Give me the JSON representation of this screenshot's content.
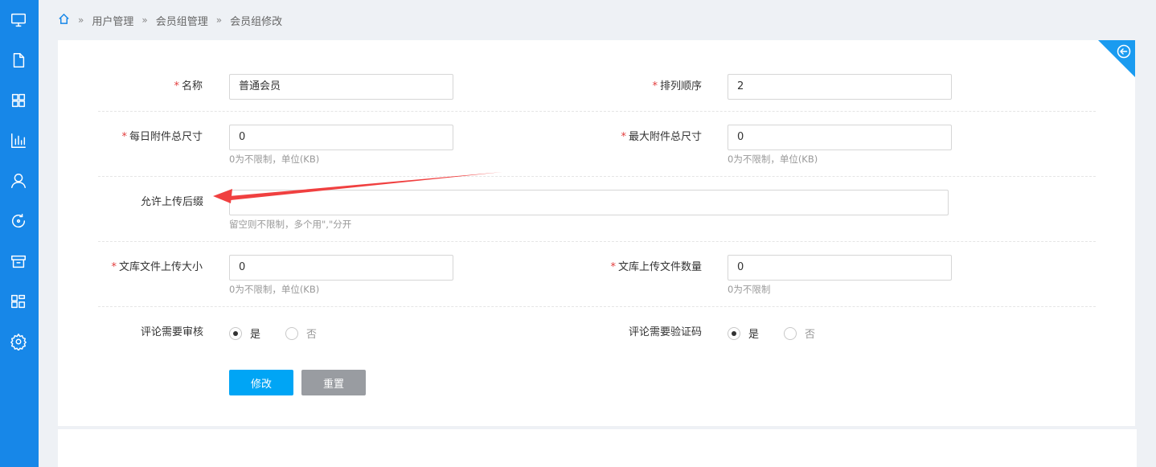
{
  "breadcrumb": {
    "items": [
      "用户管理",
      "会员组管理",
      "会员组修改"
    ],
    "separator": "»"
  },
  "sidebar": {
    "icons": [
      "monitor-icon",
      "file-icon",
      "grid-icon",
      "bar-chart-icon",
      "user-icon",
      "refresh-icon",
      "archive-icon",
      "modules-icon",
      "gear-icon"
    ]
  },
  "form": {
    "name": {
      "label": "名称",
      "value": "普通会员",
      "required": "*"
    },
    "order": {
      "label": "排列顺序",
      "value": "2",
      "required": "*"
    },
    "daily_attach": {
      "label": "每日附件总尺寸",
      "value": "0",
      "hint": "0为不限制，单位(KB)",
      "required": "*"
    },
    "max_attach": {
      "label": "最大附件总尺寸",
      "value": "0",
      "hint": "0为不限制，单位(KB)",
      "required": "*"
    },
    "suffix": {
      "label": "允许上传后缀",
      "value": "",
      "hint": "留空则不限制，多个用\",\"分开"
    },
    "lib_size": {
      "label": "文库文件上传大小",
      "value": "0",
      "hint": "0为不限制，单位(KB)",
      "required": "*"
    },
    "lib_count": {
      "label": "文库上传文件数量",
      "value": "0",
      "hint": "0为不限制",
      "required": "*"
    },
    "comment_review": {
      "label": "评论需要审核",
      "yes": "是",
      "no": "否",
      "selected": "yes"
    },
    "comment_captcha": {
      "label": "评论需要验证码",
      "yes": "是",
      "no": "否",
      "selected": "yes"
    }
  },
  "buttons": {
    "submit": "修改",
    "reset": "重置"
  },
  "colors": {
    "sidebar": "#1787e8",
    "primary": "#00a5f5",
    "gray": "#999ca1",
    "required": "#e23d3d",
    "arrow": "#f04040"
  }
}
